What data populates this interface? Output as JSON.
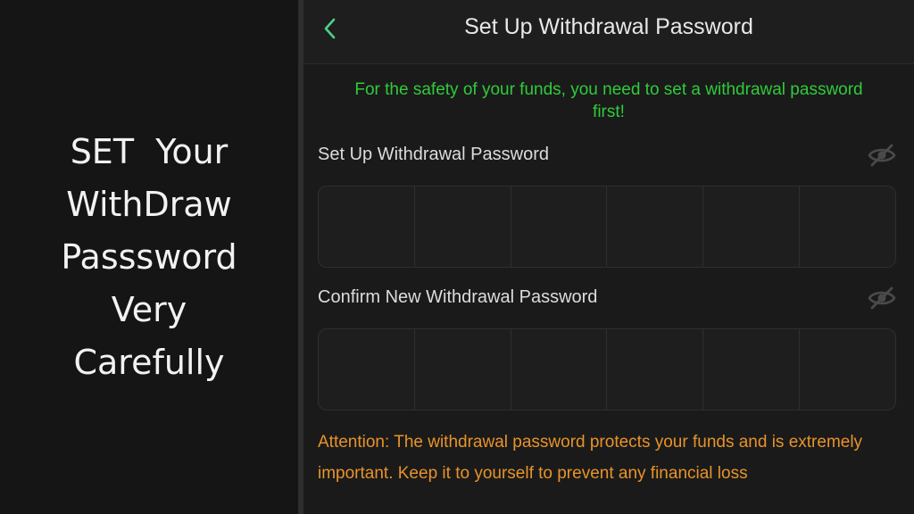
{
  "caption": {
    "lines": [
      "SET  Your",
      "WithDraw",
      "Passsword",
      "Very",
      "Carefully"
    ]
  },
  "header": {
    "title": "Set Up Withdrawal Password",
    "back_icon": "chevron-left-icon"
  },
  "notice": "For the safety of your funds, you need to set a withdrawal password first!",
  "fields": [
    {
      "label": "Set Up Withdrawal Password",
      "icon": "eye-off-icon",
      "digits": 6,
      "value": ""
    },
    {
      "label": "Confirm New Withdrawal Password",
      "icon": "eye-off-icon",
      "digits": 6,
      "value": ""
    }
  ],
  "attention": "Attention: The withdrawal password protects your funds and is extremely important. Keep it to yourself to prevent any financial loss",
  "colors": {
    "notice": "#2fcb3a",
    "attention": "#e8932a",
    "back_icon": "#4fd08a",
    "background": "#1a1a1a"
  }
}
